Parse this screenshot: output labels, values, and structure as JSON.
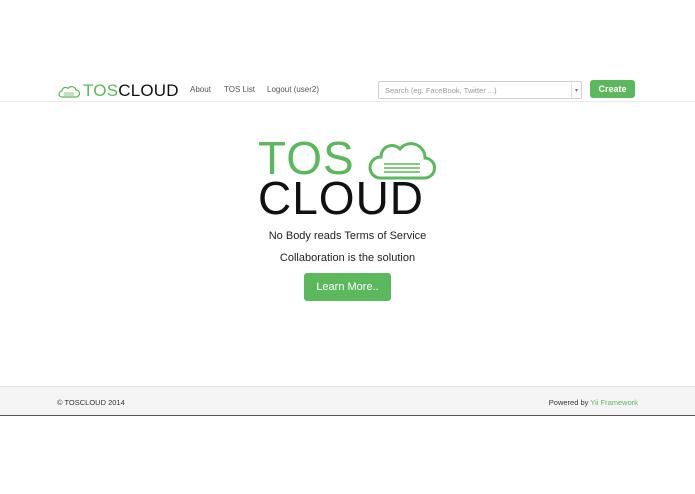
{
  "navbar": {
    "brand": {
      "tos": "TOS",
      "cloud": "CLOUD",
      "icon": "cloud-icon"
    },
    "links": [
      {
        "label": "About"
      },
      {
        "label": "TOS List"
      },
      {
        "label": "Logout (user2)"
      }
    ],
    "search": {
      "placeholder": "Search (eg. FaceBook, Twitter ...)",
      "value": "",
      "caret": "▾"
    },
    "create_label": "Create"
  },
  "hero": {
    "logo": {
      "tos": "TOS",
      "cloud": "CLOUD",
      "icon": "cloud-icon"
    },
    "tagline_1": "No Body reads Terms of Service",
    "tagline_2": "Collaboration is the solution",
    "learn_more_label": "Learn More.."
  },
  "footer": {
    "copyright": "© TOSCLOUD 2014",
    "powered_prefix": "Powered by ",
    "powered_link": "Yii Framework"
  },
  "colors": {
    "accent": "#5cb85c",
    "text": "#333333",
    "footer_bg": "#f5f5f5"
  }
}
